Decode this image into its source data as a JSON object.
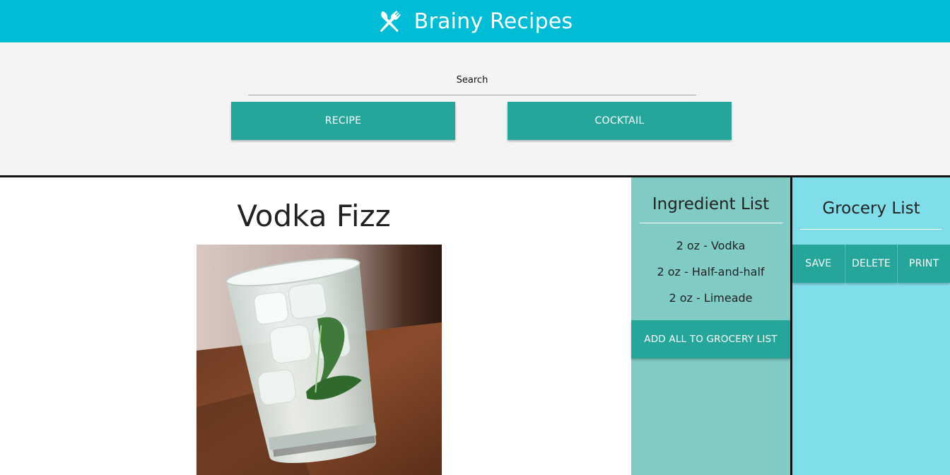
{
  "app": {
    "title": "Brainy Recipes",
    "logo_icon": "utensils-icon",
    "colors": {
      "header": "#00bcd4",
      "button": "#26a69a",
      "ingredient_panel": "#80cbc4",
      "grocery_panel": "#80deea"
    }
  },
  "search": {
    "label": "Search",
    "buttons": {
      "recipe": "RECIPE",
      "cocktail": "COCKTAIL"
    }
  },
  "recipe": {
    "title": "Vodka Fizz",
    "image_icon": "cocktail-photo"
  },
  "ingredients": {
    "title": "Ingredient List",
    "items": [
      "2 oz - Vodka",
      "2 oz - Half-and-half",
      "2 oz - Limeade"
    ],
    "add_all_label": "ADD ALL TO GROCERY LIST"
  },
  "grocery": {
    "title": "Grocery List",
    "buttons": {
      "save": "SAVE",
      "delete": "DELETE",
      "print": "PRINT"
    }
  }
}
